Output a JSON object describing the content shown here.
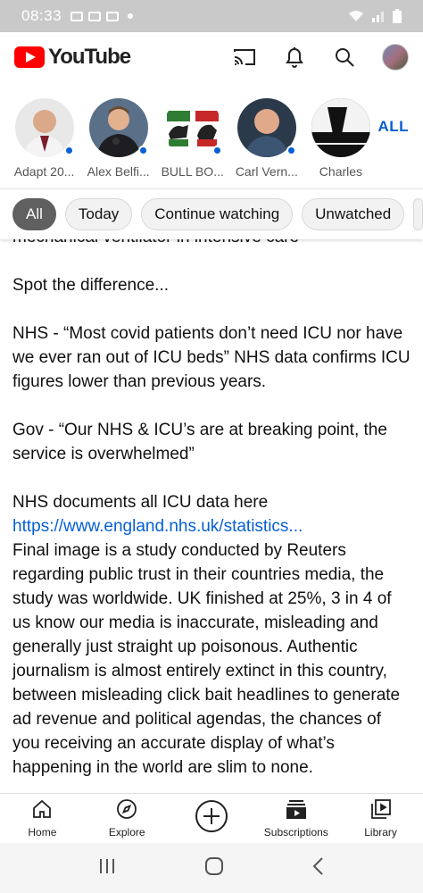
{
  "status_bar": {
    "time": "08:33"
  },
  "app": {
    "brand": "YouTube",
    "brand_color": "#ff0000",
    "accent": "#065fd4"
  },
  "subscriptions": {
    "channels": [
      {
        "name": "Adapt 20..."
      },
      {
        "name": "Alex Belfi..."
      },
      {
        "name": "BULL BO..."
      },
      {
        "name": "Carl Vern..."
      },
      {
        "name": "Charles"
      }
    ],
    "all_label": "ALL"
  },
  "chips": [
    "All",
    "Today",
    "Continue watching",
    "Unwatched"
  ],
  "post": {
    "cut_top": "mechanical ventilator in intensive care",
    "p1": "Spot the difference...",
    "p2": "NHS - “Most covid patients don’t need ICU nor have we ever ran out of ICU beds” NHS data confirms ICU figures lower than previous years.",
    "p3": "Gov - “Our NHS & ICU’s are at breaking point, the service is overwhelmed”",
    "p4": "NHS documents all ICU data here",
    "link": "https://www.england.nhs.uk/statistics...",
    "p5": "Final image is a study conducted by Reuters regarding public trust in their countries media, the study was worldwide. UK finished at 25%, 3 in 4 of us know our media is inaccurate, misleading and generally just straight up poisonous. Authentic journalism is almost entirely extinct in this country, between misleading click bait headlines to generate ad revenue and political agendas, the chances of you receiving an accurate display of what’s happening in the world are slim to none."
  },
  "bottom_nav": {
    "home": "Home",
    "explore": "Explore",
    "subscriptions": "Subscriptions",
    "library": "Library"
  }
}
